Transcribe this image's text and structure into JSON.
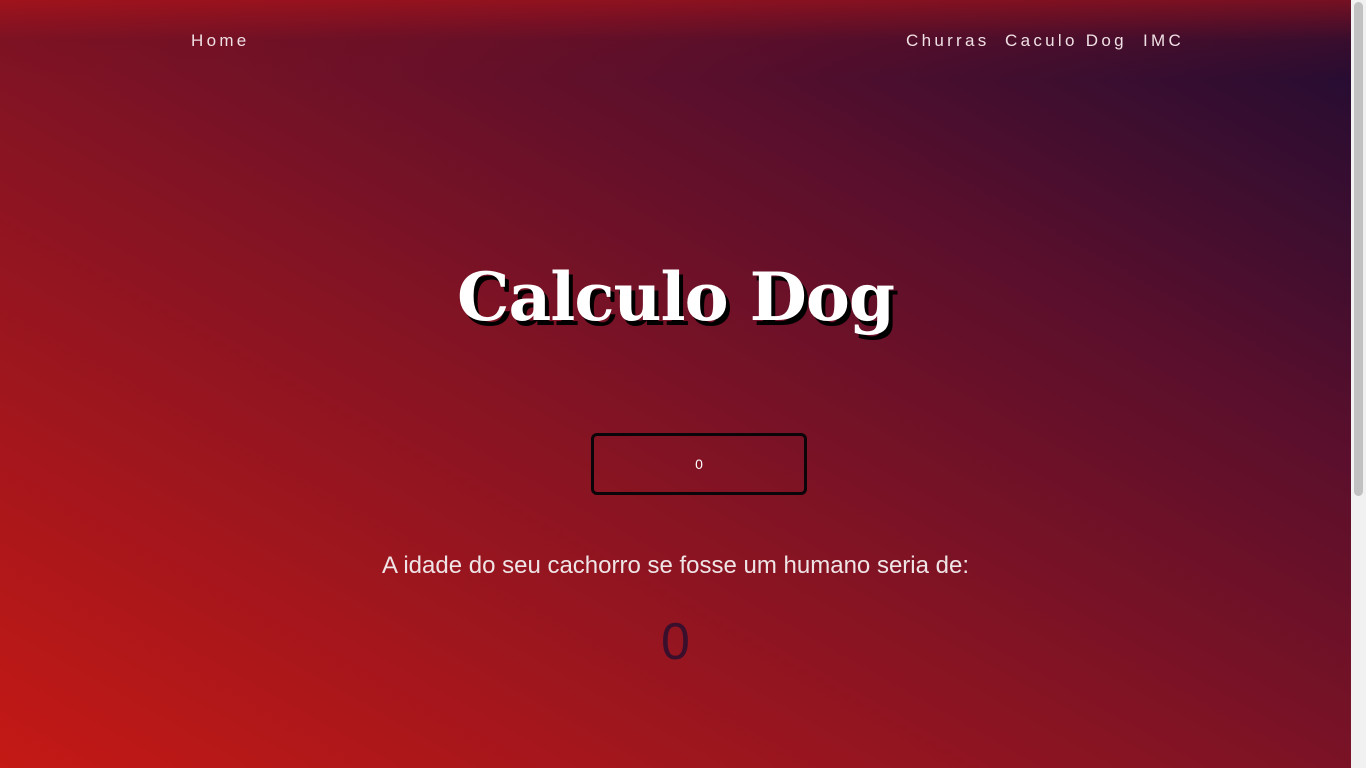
{
  "nav": {
    "home": "Home",
    "links": [
      "Churras",
      "Caculo Dog",
      "IMC"
    ]
  },
  "main": {
    "title": "Calculo Dog",
    "input_value": "0",
    "result_label": "A idade do seu cachorro se fosse um humano seria de:",
    "result_value": "0"
  },
  "colors": {
    "gradient_start": "#c41915",
    "gradient_end": "#1c0c33",
    "result_value": "#3a0f2c"
  }
}
